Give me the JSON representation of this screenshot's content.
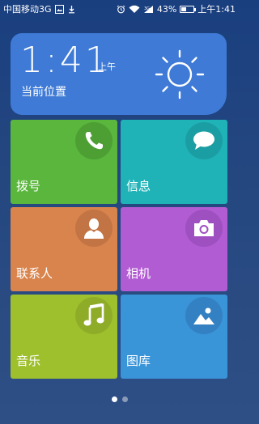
{
  "status_bar": {
    "carrier": "中国移动3G",
    "battery_percent": "43%",
    "battery_level": 0.43,
    "time": "上午1:41",
    "icons": [
      "image-icon",
      "download-icon",
      "alarm-icon",
      "wifi-icon",
      "signal-icon",
      "battery-icon"
    ]
  },
  "weather": {
    "time": "1:41",
    "ampm": "上午",
    "location": "当前位置",
    "icon": "sun-icon"
  },
  "tiles": [
    {
      "label": "拨号",
      "icon": "phone-icon",
      "color": "#5ab63c"
    },
    {
      "label": "信息",
      "icon": "message-icon",
      "color": "#1fb3b8"
    },
    {
      "label": "联系人",
      "icon": "contact-icon",
      "color": "#d9844d"
    },
    {
      "label": "相机",
      "icon": "camera-icon",
      "color": "#b25cd3"
    },
    {
      "label": "音乐",
      "icon": "music-icon",
      "color": "#9fc02d"
    },
    {
      "label": "图库",
      "icon": "gallery-icon",
      "color": "#3a94d8"
    }
  ],
  "pager": {
    "pages": 2,
    "active": 1
  }
}
